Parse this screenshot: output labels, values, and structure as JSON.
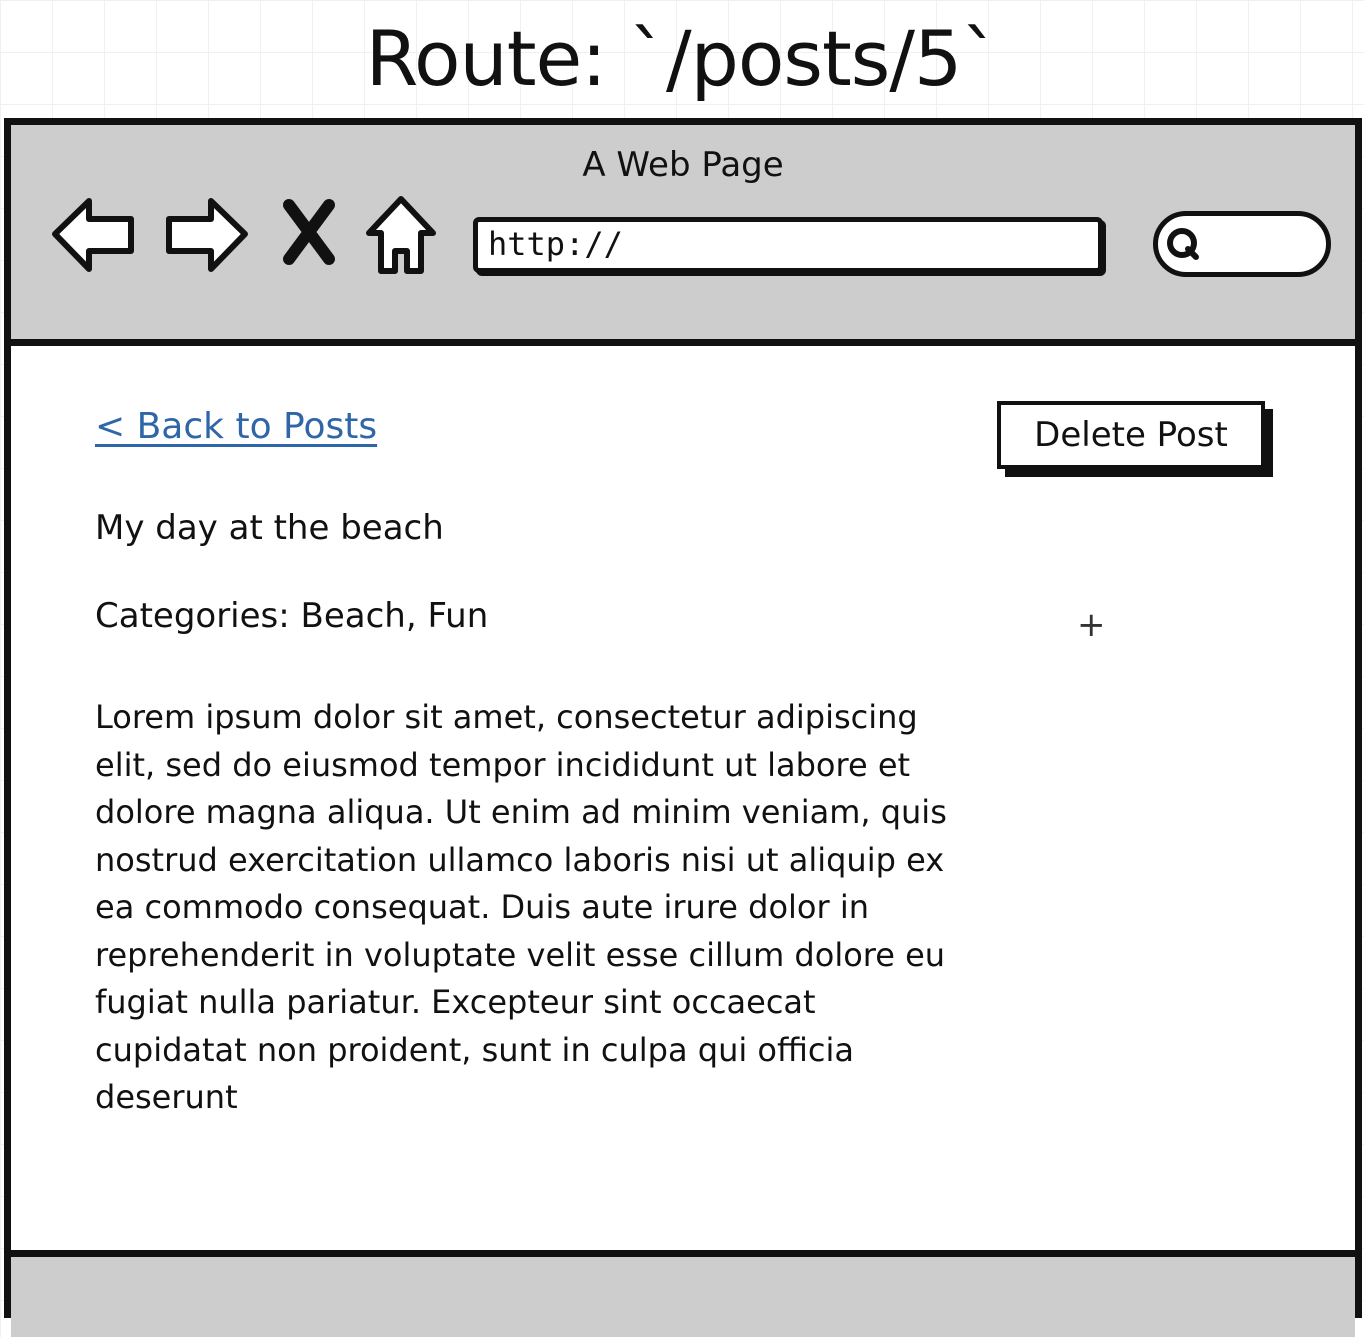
{
  "route_title": "Route: `/posts/5`",
  "browser": {
    "window_title": "A Web Page",
    "url": "http://",
    "icons": {
      "back": "back-arrow-icon",
      "forward": "forward-arrow-icon",
      "stop": "close-icon",
      "home": "home-icon",
      "search": "search-icon"
    }
  },
  "page": {
    "back_link": "< Back to Posts",
    "delete_button": "Delete Post",
    "post_title": "My day at the beach",
    "categories": "Categories: Beach, Fun",
    "body": "Lorem ipsum dolor sit amet, consectetur adipiscing elit, sed do eiusmod tempor incididunt ut labore et dolore magna aliqua. Ut enim ad minim veniam, quis nostrud exercitation ullamco laboris nisi ut aliquip ex ea commodo consequat. Duis aute irure dolor in reprehenderit in voluptate velit esse cillum dolore eu fugiat nulla pariatur. Excepteur sint occaecat cupidatat non proident, sunt in culpa qui officia deserunt"
  }
}
